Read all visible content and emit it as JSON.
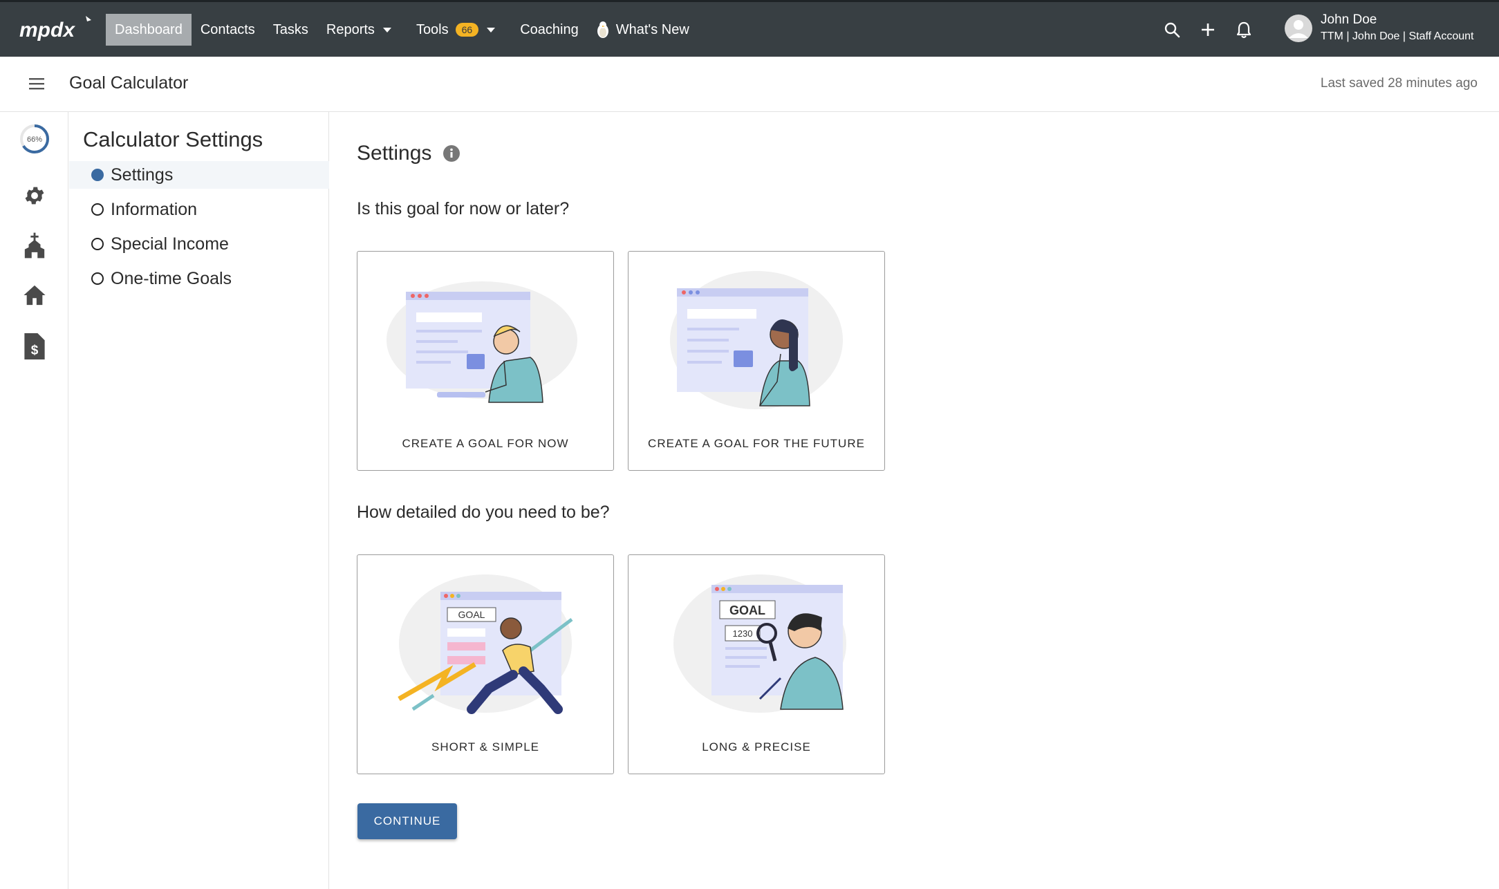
{
  "app": {
    "logo_text": "mpdx"
  },
  "nav": {
    "items": [
      {
        "label": "Dashboard",
        "active": true
      },
      {
        "label": "Contacts"
      },
      {
        "label": "Tasks"
      },
      {
        "label": "Reports"
      },
      {
        "label": "Tools",
        "badge": "66"
      },
      {
        "label": "Coaching"
      },
      {
        "label": "What's New"
      }
    ]
  },
  "user": {
    "name": "John Doe",
    "subtitle": "TTM | John Doe | Staff Account"
  },
  "header": {
    "title": "Goal Calculator",
    "saved": "Last saved 28 minutes ago"
  },
  "progress": {
    "label": "66%",
    "value": 0.66
  },
  "steps": {
    "title": "Calculator Settings",
    "items": [
      {
        "label": "Settings",
        "active": true
      },
      {
        "label": "Information"
      },
      {
        "label": "Special Income"
      },
      {
        "label": "One-time Goals"
      }
    ]
  },
  "main": {
    "title": "Settings",
    "q1": "Is this goal for now or later?",
    "q2": "How detailed do you need to be?",
    "cards": {
      "now": "CREATE A GOAL FOR NOW",
      "future": "CREATE A GOAL FOR THE FUTURE",
      "short": "SHORT & SIMPLE",
      "long": "LONG & PRECISE"
    },
    "illustration_text": {
      "goal_small": "GOAL",
      "goal_large": "GOAL",
      "number": "1230"
    },
    "continue": "CONTINUE"
  },
  "colors": {
    "topbar": "#383f43",
    "primary": "#3a6aa1",
    "badge": "#f4b323",
    "active_nav": "#a7abae"
  }
}
